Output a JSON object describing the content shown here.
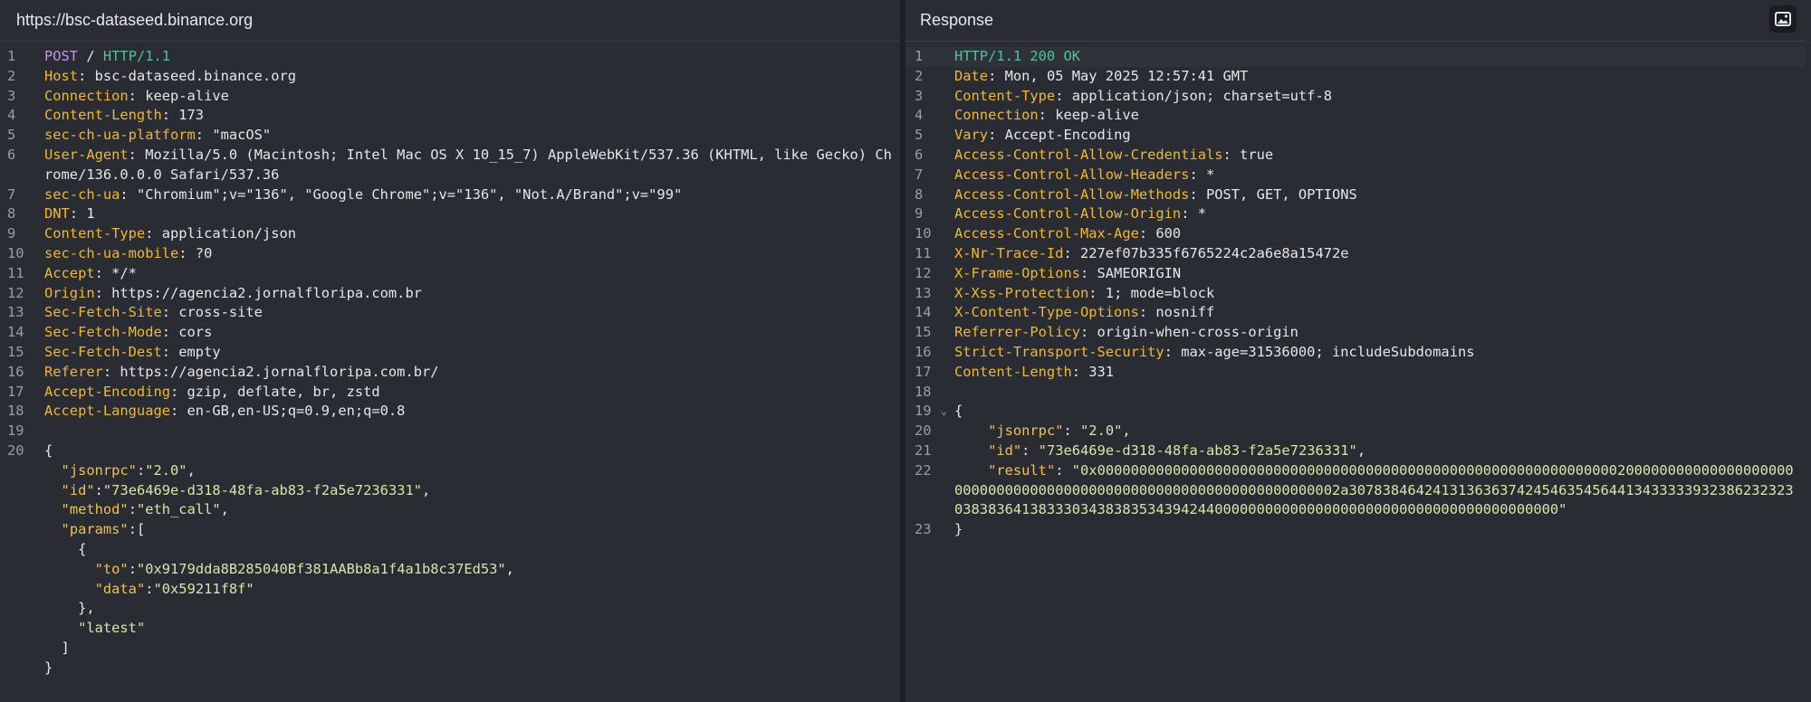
{
  "request": {
    "title": "https://bsc-dataseed.binance.org",
    "start_line": {
      "method": "POST",
      "path": "/",
      "version": "HTTP/1.1"
    },
    "headers": [
      {
        "name": "Host",
        "value": "bsc-dataseed.binance.org"
      },
      {
        "name": "Connection",
        "value": "keep-alive"
      },
      {
        "name": "Content-Length",
        "value": "173"
      },
      {
        "name": "sec-ch-ua-platform",
        "value": "\"macOS\""
      },
      {
        "name": "User-Agent",
        "value": "Mozilla/5.0 (Macintosh; Intel Mac OS X 10_15_7) AppleWebKit/537.36 (KHTML, like Gecko) Chrome/136.0.0.0 Safari/537.36"
      },
      {
        "name": "sec-ch-ua",
        "value": "\"Chromium\";v=\"136\", \"Google Chrome\";v=\"136\", \"Not.A/Brand\";v=\"99\""
      },
      {
        "name": "DNT",
        "value": "1"
      },
      {
        "name": "Content-Type",
        "value": "application/json"
      },
      {
        "name": "sec-ch-ua-mobile",
        "value": "?0"
      },
      {
        "name": "Accept",
        "value": "*/*"
      },
      {
        "name": "Origin",
        "value": "https://agencia2.jornalfloripa.com.br"
      },
      {
        "name": "Sec-Fetch-Site",
        "value": "cross-site"
      },
      {
        "name": "Sec-Fetch-Mode",
        "value": "cors"
      },
      {
        "name": "Sec-Fetch-Dest",
        "value": "empty"
      },
      {
        "name": "Referer",
        "value": "https://agencia2.jornalfloripa.com.br/"
      },
      {
        "name": "Accept-Encoding",
        "value": "gzip, deflate, br, zstd"
      },
      {
        "name": "Accept-Language",
        "value": "en-GB,en-US;q=0.9,en;q=0.8"
      }
    ],
    "body": {
      "jsonrpc": "2.0",
      "id": "73e6469e-d318-48fa-ab83-f2a5e7236331",
      "method": "eth_call",
      "to": "0x9179dda8B285040Bf381AABb8a1f4a1b8c37Ed53",
      "data": "0x59211f8f",
      "block": "latest"
    }
  },
  "response": {
    "title": "Response",
    "status_line": {
      "version": "HTTP/1.1",
      "code": "200",
      "reason": "OK"
    },
    "headers": [
      {
        "name": "Date",
        "value": "Mon, 05 May 2025 12:57:41 GMT"
      },
      {
        "name": "Content-Type",
        "value": "application/json; charset=utf-8"
      },
      {
        "name": "Connection",
        "value": "keep-alive"
      },
      {
        "name": "Vary",
        "value": "Accept-Encoding"
      },
      {
        "name": "Access-Control-Allow-Credentials",
        "value": "true"
      },
      {
        "name": "Access-Control-Allow-Headers",
        "value": "*"
      },
      {
        "name": "Access-Control-Allow-Methods",
        "value": "POST, GET, OPTIONS"
      },
      {
        "name": "Access-Control-Allow-Origin",
        "value": "*"
      },
      {
        "name": "Access-Control-Max-Age",
        "value": "600"
      },
      {
        "name": "X-Nr-Trace-Id",
        "value": "227ef07b335f6765224c2a6e8a15472e"
      },
      {
        "name": "X-Frame-Options",
        "value": "SAMEORIGIN"
      },
      {
        "name": "X-Xss-Protection",
        "value": "1; mode=block"
      },
      {
        "name": "X-Content-Type-Options",
        "value": "nosniff"
      },
      {
        "name": "Referrer-Policy",
        "value": "origin-when-cross-origin"
      },
      {
        "name": "Strict-Transport-Security",
        "value": "max-age=31536000; includeSubdomains"
      },
      {
        "name": "Content-Length",
        "value": "331"
      }
    ],
    "body": {
      "jsonrpc": "2.0",
      "id": "73e6469e-d318-48fa-ab83-f2a5e7236331",
      "result": "0x000000000000000000000000000000000000000000000000000000000000002000000000000000000000000000000000000000000000000000000000000000002a30783846424131363637424546354564413433333932386232323038383641383330343838353439424400000000000000000000000000000000000000000"
    }
  },
  "icons": {
    "image_button": "image-icon"
  }
}
